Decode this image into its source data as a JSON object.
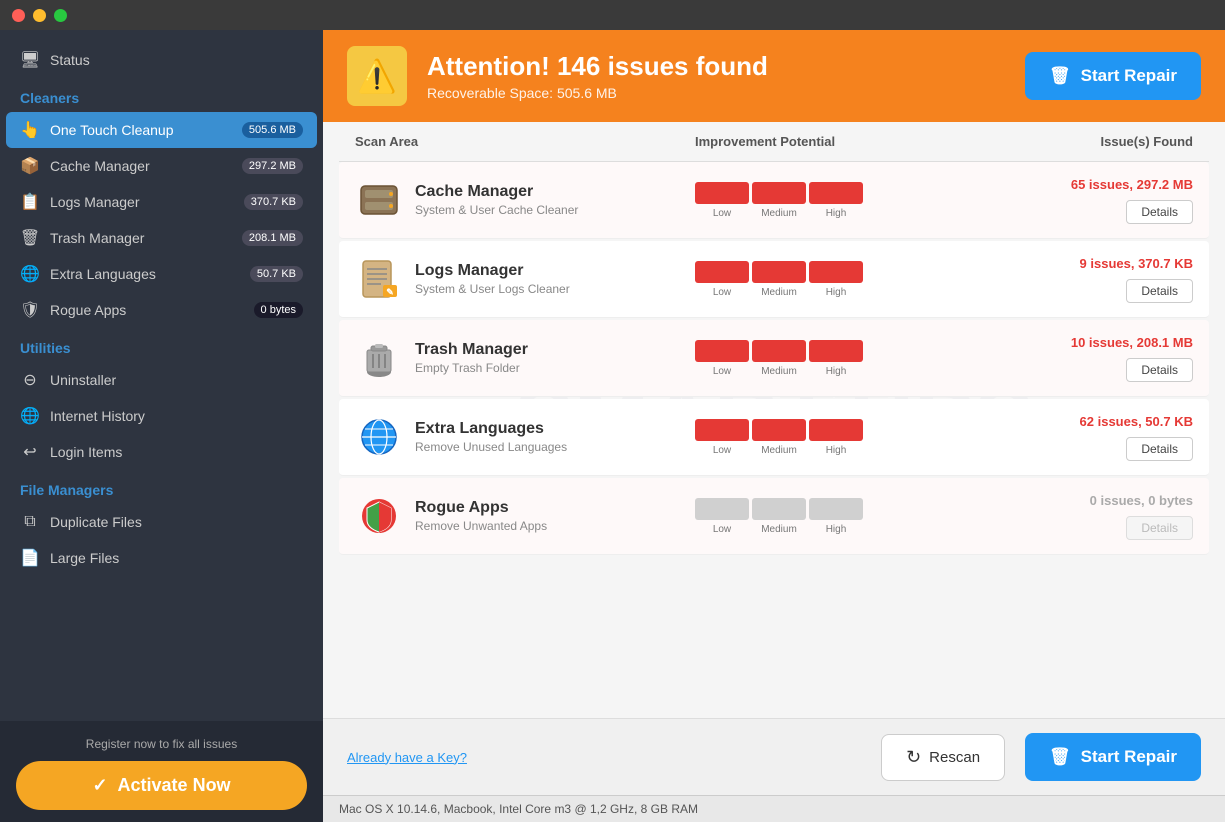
{
  "window": {
    "dots": [
      "red",
      "yellow",
      "green"
    ]
  },
  "sidebar": {
    "status_label": "Status",
    "sections": [
      {
        "label": "Cleaners",
        "items": [
          {
            "id": "one-touch-cleanup",
            "label": "One Touch Cleanup",
            "badge": "505.6 MB",
            "active": true
          },
          {
            "id": "cache-manager",
            "label": "Cache Manager",
            "badge": "297.2 MB",
            "active": false
          },
          {
            "id": "logs-manager",
            "label": "Logs Manager",
            "badge": "370.7 KB",
            "active": false
          },
          {
            "id": "trash-manager",
            "label": "Trash Manager",
            "badge": "208.1 MB",
            "active": false
          },
          {
            "id": "extra-languages",
            "label": "Extra Languages",
            "badge": "50.7 KB",
            "active": false
          },
          {
            "id": "rogue-apps",
            "label": "Rogue Apps",
            "badge": "0 bytes",
            "active": false
          }
        ]
      },
      {
        "label": "Utilities",
        "items": [
          {
            "id": "uninstaller",
            "label": "Uninstaller",
            "badge": "",
            "active": false
          },
          {
            "id": "internet-history",
            "label": "Internet History",
            "badge": "",
            "active": false
          },
          {
            "id": "login-items",
            "label": "Login Items",
            "badge": "",
            "active": false
          }
        ]
      },
      {
        "label": "File Managers",
        "items": [
          {
            "id": "duplicate-files",
            "label": "Duplicate Files",
            "badge": "",
            "active": false
          },
          {
            "id": "large-files",
            "label": "Large Files",
            "badge": "",
            "active": false
          }
        ]
      }
    ],
    "register_text": "Register now to fix all issues",
    "activate_label": "Activate Now"
  },
  "alert": {
    "title": "Attention! 146 issues found",
    "subtitle": "Recoverable Space: 505.6 MB",
    "start_repair_label": "Start Repair"
  },
  "table": {
    "columns": [
      "Scan Area",
      "Improvement Potential",
      "Issue(s) Found"
    ],
    "rows": [
      {
        "id": "cache-manager",
        "name": "Cache Manager",
        "desc": "System & User Cache Cleaner",
        "bar": [
          true,
          true,
          true
        ],
        "issues": "65 issues, 297.2 MB",
        "has_details": true
      },
      {
        "id": "logs-manager",
        "name": "Logs Manager",
        "desc": "System & User Logs Cleaner",
        "bar": [
          true,
          true,
          true
        ],
        "issues": "9 issues, 370.7 KB",
        "has_details": true
      },
      {
        "id": "trash-manager",
        "name": "Trash Manager",
        "desc": "Empty Trash Folder",
        "bar": [
          true,
          true,
          true
        ],
        "issues": "10 issues, 208.1 MB",
        "has_details": true
      },
      {
        "id": "extra-languages",
        "name": "Extra Languages",
        "desc": "Remove Unused Languages",
        "bar": [
          true,
          true,
          true
        ],
        "issues": "62 issues, 50.7 KB",
        "has_details": true
      },
      {
        "id": "rogue-apps",
        "name": "Rogue Apps",
        "desc": "Remove Unwanted Apps",
        "bar": [
          false,
          false,
          false
        ],
        "issues": "0 issues, 0 bytes",
        "has_details": false
      }
    ]
  },
  "footer": {
    "already_key_label": "Already have a Key?",
    "rescan_label": "Rescan",
    "start_repair_label": "Start Repair"
  },
  "statusbar": {
    "text": "Mac OS X 10.14.6, Macbook, Intel Core m3 @ 1,2 GHz, 8 GB RAM"
  },
  "icons": {
    "monitor": "🖥",
    "hand": "👆",
    "cache": "📦",
    "logs": "📋",
    "trash": "🗑",
    "globe": "🌐",
    "shield": "🛡",
    "uninstaller": "⊖",
    "login": "↩",
    "duplicate": "⧉",
    "large": "📄",
    "warning": "⚠",
    "repair": "🗑",
    "check": "✓",
    "refresh": "↻"
  }
}
